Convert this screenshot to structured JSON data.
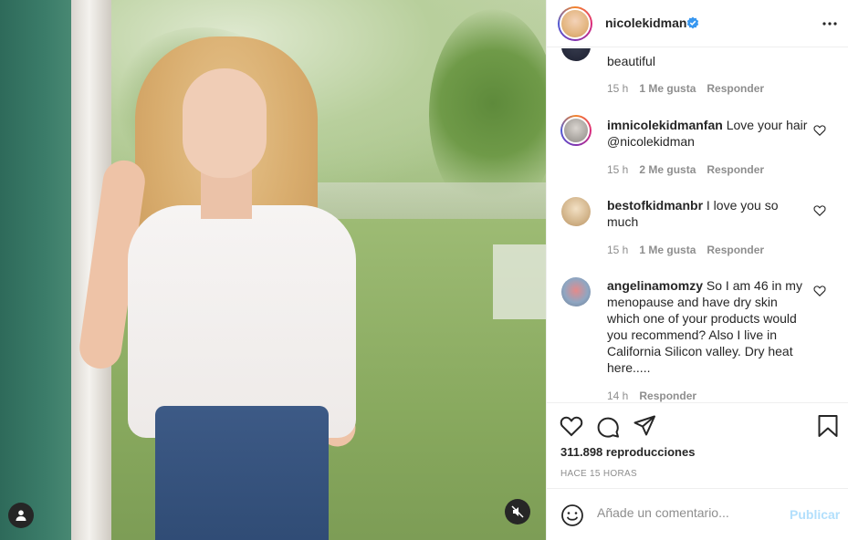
{
  "post": {
    "username": "nicolekidman",
    "verified": true,
    "views_count": "311.898",
    "views_label": "reproducciones",
    "time_ago": "HACE 15 HORAS"
  },
  "comments": [
    {
      "username": "",
      "text": "beautiful",
      "time": "15 h",
      "likes": "1 Me gusta",
      "reply": "Responder"
    },
    {
      "username": "imnicolekidmanfan",
      "text": "Love your hair @nicolekidman",
      "time": "15 h",
      "likes": "2 Me gusta",
      "reply": "Responder"
    },
    {
      "username": "bestofkidmanbr",
      "text": "I love you so much",
      "time": "15 h",
      "likes": "1 Me gusta",
      "reply": "Responder"
    },
    {
      "username": "angelinamomzy",
      "text": "So I am 46 in my menopause and have dry skin which one of your products would you recommend? Also I live in California Silicon valley. Dry heat here.....",
      "time": "14 h",
      "reply": "Responder"
    }
  ],
  "comment_box": {
    "placeholder": "Añade un comentario...",
    "publish_label": "Publicar"
  },
  "icons": {
    "verified": "verified-badge-icon",
    "more": "more-options-icon",
    "like": "heart-icon",
    "comment": "comment-bubble-icon",
    "share": "paper-plane-icon",
    "save": "bookmark-icon",
    "emoji": "emoji-smiley-icon",
    "user": "user-tag-icon",
    "mute": "volume-muted-icon"
  },
  "colors": {
    "verified": "#3897f0",
    "publish_disabled": "#b2dffc",
    "meta_text": "#8e8e8e"
  }
}
